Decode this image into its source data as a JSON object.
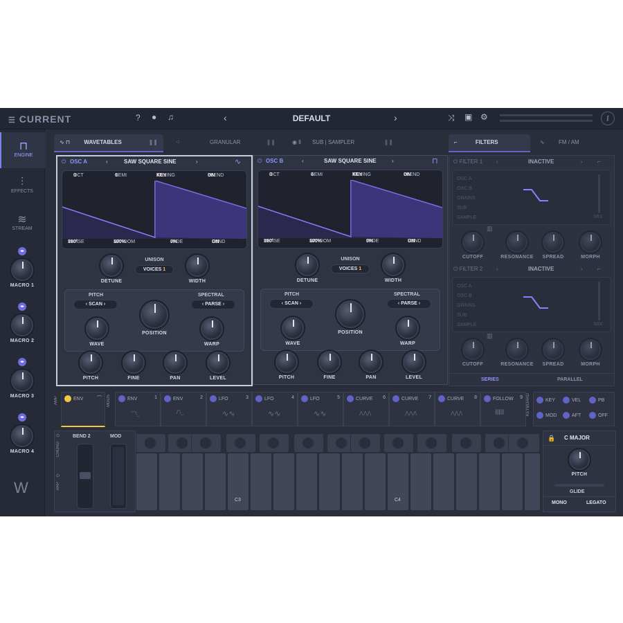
{
  "header": {
    "app_title": "CURRENT",
    "preset_name": "DEFAULT",
    "prev": "‹",
    "next": "›"
  },
  "sidebar": {
    "items": [
      {
        "label": "ENGINE",
        "icon": "engine-icon"
      },
      {
        "label": "EFFECTS",
        "icon": "effects-icon"
      },
      {
        "label": "STREAM",
        "icon": "stream-icon"
      }
    ],
    "macros": [
      "MACRO 1",
      "MACRO 2",
      "MACRO 3",
      "MACRO 4"
    ]
  },
  "tabs": {
    "wavetables": "WAVETABLES",
    "granular": "GRANULAR",
    "sub_sampler": "SUB | SAMPLER",
    "filters": "FILTERS",
    "fm_am": "FM / AM"
  },
  "osc_a": {
    "name": "OSC A",
    "wavetable": "SAW SQUARE SINE",
    "oct_label": "OCT",
    "oct": "0",
    "semi_label": "SEMI",
    "semi": "0",
    "tuning_label": "TUNING",
    "tuning": "KEY",
    "blend_label": "BLEND",
    "blend": "ON",
    "phase_label": "PHASE",
    "phase": "180°",
    "random_label": "RANDOM",
    "random": "100%",
    "fade_label": "FADE",
    "fade": "0%",
    "fund_label": "FUND",
    "fund": "ON",
    "detune": "DETUNE",
    "unison": "UNISON",
    "voices_label": "VOICES",
    "voices": "1",
    "width": "WIDTH",
    "pitch_label": "PITCH",
    "scan": "SCAN",
    "spectral_label": "SPECTRAL",
    "parse": "PARSE",
    "wave": "WAVE",
    "position": "POSITION",
    "warp": "WARP",
    "k_pitch": "PITCH",
    "k_fine": "FINE",
    "k_pan": "PAN",
    "k_level": "LEVEL"
  },
  "osc_b": {
    "name": "OSC B",
    "wavetable": "SAW SQUARE SINE",
    "oct_label": "OCT",
    "oct": "0",
    "semi_label": "SEMI",
    "semi": "0",
    "tuning_label": "TUNING",
    "tuning": "KEY",
    "blend_label": "BLEND",
    "blend": "ON",
    "phase_label": "PHASE",
    "phase": "180°",
    "random_label": "RANDOM",
    "random": "100%",
    "fade_label": "FADE",
    "fade": "0%",
    "fund_label": "FUND",
    "fund": "ON",
    "detune": "DETUNE",
    "unison": "UNISON",
    "voices_label": "VOICES",
    "voices": "1",
    "width": "WIDTH",
    "pitch_label": "PITCH",
    "scan": "SCAN",
    "spectral_label": "SPECTRAL",
    "parse": "PARSE",
    "wave": "WAVE",
    "position": "POSITION",
    "warp": "WARP",
    "k_pitch": "PITCH",
    "k_fine": "FINE",
    "k_pan": "PAN",
    "k_level": "LEVEL"
  },
  "filter1": {
    "name": "FILTER 1",
    "state": "INACTIVE",
    "sources": [
      "OSC A",
      "OSC B",
      "GRAINS",
      "SUB",
      "SAMPLE"
    ],
    "mix": "MIX",
    "cutoff": "CUTOFF",
    "resonance": "RESONANCE",
    "spread": "SPREAD",
    "morph": "MORPH"
  },
  "filter2": {
    "name": "FILTER 2",
    "state": "INACTIVE",
    "sources": [
      "OSC A",
      "OSC B",
      "GRAINS",
      "SUB",
      "SAMPLE"
    ],
    "mix": "MIX",
    "cutoff": "CUTOFF",
    "resonance": "RESONANCE",
    "spread": "SPREAD",
    "morph": "MORPH"
  },
  "routing": {
    "series": "SERIES",
    "parallel": "PARALLEL"
  },
  "mods": {
    "amp_label": "AMP",
    "mods_label": "MODS",
    "amp_env": "ENV",
    "slots": [
      {
        "name": "ENV",
        "num": "1"
      },
      {
        "name": "ENV",
        "num": "2"
      },
      {
        "name": "LFO",
        "num": "3"
      },
      {
        "name": "LFO",
        "num": "4"
      },
      {
        "name": "LFO",
        "num": "5"
      },
      {
        "name": "CURVE",
        "num": "6"
      },
      {
        "name": "CURVE",
        "num": "7"
      },
      {
        "name": "CURVE",
        "num": "8"
      },
      {
        "name": "FOLLOW",
        "num": "9"
      }
    ],
    "keyboard_label": "KEYBOARD",
    "kb": [
      "KEY",
      "VEL",
      "PB",
      "MOD",
      "AFT",
      "OFF"
    ]
  },
  "keyboard": {
    "bend": "BEND",
    "bend_val": "2",
    "mod": "MOD",
    "chord": "CHORD",
    "arp": "ARP",
    "c3": "C3",
    "c4": "C4",
    "scale": "C MAJOR",
    "pitch": "PITCH",
    "glide": "GLIDE",
    "mono": "MONO",
    "legato": "LEGATO"
  },
  "colors": {
    "accent": "#7d7ff0",
    "background": "#2a2e3b",
    "wave_fill": "#4b3f9e"
  }
}
